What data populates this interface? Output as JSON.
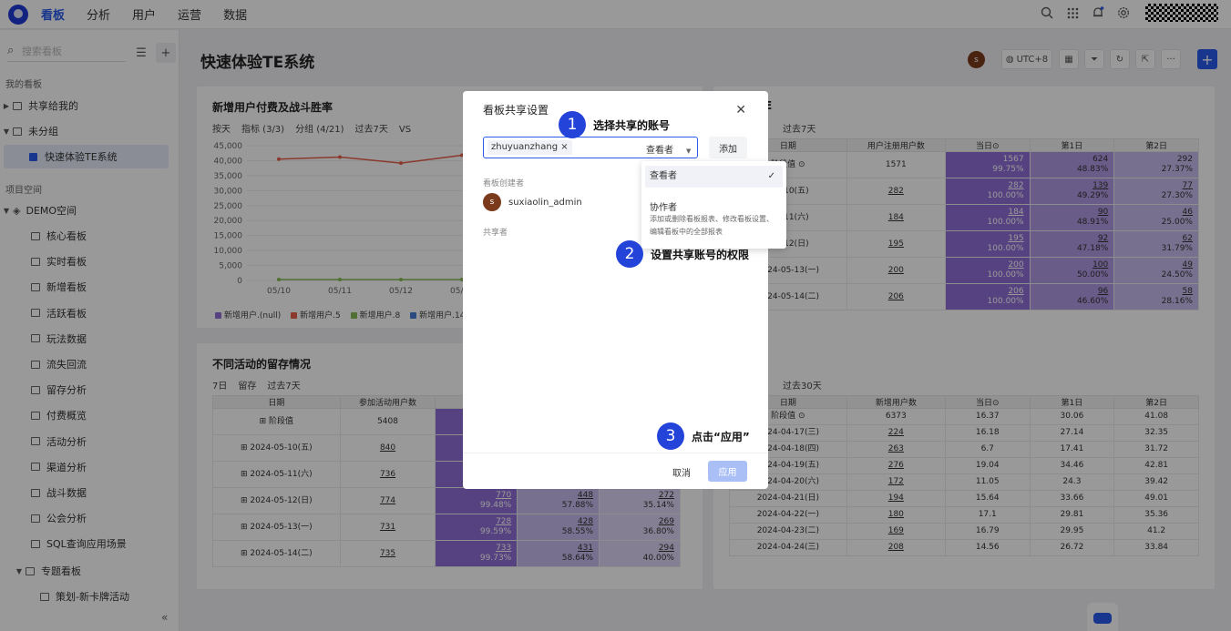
{
  "topnav": [
    "看板",
    "分析",
    "用户",
    "运营",
    "数据"
  ],
  "sidebar": {
    "search_placeholder": "搜索看板",
    "my_boards_label": "我的看板",
    "shared_to_me": "共享给我的",
    "ungrouped": "未分组",
    "selected_board": "快速体验TE系统",
    "project_space_label": "项目空间",
    "demo_space": "DEMO空间",
    "boards": [
      "核心看板",
      "实时看板",
      "新增看板",
      "活跃看板",
      "玩法数据",
      "流失回流",
      "留存分析",
      "付费概览",
      "活动分析",
      "渠道分析",
      "战斗数据",
      "公会分析",
      "SQL查询应用场景"
    ],
    "topic_group": "专题看板",
    "topic_item": "策划-新卡牌活动"
  },
  "page": {
    "title": "快速体验TE系统",
    "avatar": "s",
    "timezone": "UTC+8",
    "more": "···",
    "add": "+"
  },
  "card1": {
    "title": "新增用户付费及战斗胜率",
    "filters": [
      "按天",
      "指标 (3/3)",
      "分组 (4/21)",
      "过去7天",
      "VS"
    ],
    "legend": [
      "新增用户.(null)",
      "新增用户.5",
      "新增用户.8",
      "新增用户.14"
    ],
    "legend_colors": [
      "#8f6fd6",
      "#e8604c",
      "#88bb55",
      "#4a7fd6"
    ]
  },
  "chart_data": {
    "type": "line",
    "x": [
      "05/10",
      "05/11",
      "05/12",
      "05/13"
    ],
    "ylim": [
      0,
      45000
    ],
    "yticks": [
      "45,000",
      "40,000",
      "35,000",
      "30,000",
      "25,000",
      "20,000",
      "15,000",
      "10,000",
      "5,000",
      "0"
    ],
    "series": [
      {
        "name": "新增用户.5",
        "values": [
          40500,
          41200,
          39200,
          41800
        ]
      },
      {
        "name": "新增用户.8",
        "values": [
          300,
          300,
          300,
          300
        ]
      }
    ]
  },
  "card2": {
    "title": "不同活动的留存情况",
    "filters": [
      "7日",
      "留存",
      "过去7天"
    ],
    "headers": [
      "日期",
      "参加活动用户数"
    ],
    "rows": [
      {
        "date": "阶段值",
        "n": "5408",
        "c1": "",
        "c1b": "",
        "c2": "",
        "c2b": "",
        "c3": "",
        "c3b": ""
      },
      {
        "date": "2024-05-10(五)",
        "n": "840",
        "c1": "",
        "c1b": "",
        "c2": "",
        "c2b": "",
        "c3": "",
        "c3b": ""
      },
      {
        "date": "2024-05-11(六)",
        "n": "736",
        "c1": "",
        "c1b": "",
        "c2": "",
        "c2b": "",
        "c3": "",
        "c3b": ""
      },
      {
        "date": "2024-05-12(日)",
        "n": "774",
        "c1": "770",
        "c1b": "99.48%",
        "c2": "448",
        "c2b": "57.88%",
        "c3": "272",
        "c3b": "35.14%"
      },
      {
        "date": "2024-05-13(一)",
        "n": "731",
        "c1": "728",
        "c1b": "99.59%",
        "c2": "428",
        "c2b": "58.55%",
        "c3": "269",
        "c3b": "36.80%"
      },
      {
        "date": "2024-05-14(二)",
        "n": "735",
        "c1": "733",
        "c1b": "99.73%",
        "c2": "431",
        "c2b": "58.64%",
        "c3": "294",
        "c3b": "40.00%"
      }
    ]
  },
  "card3": {
    "title_fragment": "E",
    "filters": [
      "过去7天"
    ],
    "headers": [
      "日期",
      "用户注册用户数",
      "当日⊙",
      "第1日",
      "第2日"
    ],
    "rows": [
      {
        "date": "阶段值 ⊙",
        "n": "1571",
        "d0": "1567",
        "d0b": "99.75%",
        "d1": "624",
        "d1b": "48.83%",
        "d2": "292",
        "d2b": "27.37%"
      },
      {
        "date": "-05-10(五)",
        "n": "282",
        "d0": "282",
        "d0b": "100.00%",
        "d1": "139",
        "d1b": "49.29%",
        "d2": "77",
        "d2b": "27.30%"
      },
      {
        "date": "-05-11(六)",
        "n": "184",
        "d0": "184",
        "d0b": "100.00%",
        "d1": "90",
        "d1b": "48.91%",
        "d2": "46",
        "d2b": "25.00%"
      },
      {
        "date": "-05-12(日)",
        "n": "195",
        "d0": "195",
        "d0b": "100.00%",
        "d1": "92",
        "d1b": "47.18%",
        "d2": "62",
        "d2b": "31.79%"
      },
      {
        "date": "2024-05-13(一)",
        "n": "200",
        "d0": "200",
        "d0b": "100.00%",
        "d1": "100",
        "d1b": "50.00%",
        "d2": "49",
        "d2b": "24.50%"
      },
      {
        "date": "2024-05-14(二)",
        "n": "206",
        "d0": "206",
        "d0b": "100.00%",
        "d1": "96",
        "d1b": "46.60%",
        "d2": "58",
        "d2b": "28.16%"
      }
    ]
  },
  "card4": {
    "filters": [
      "过去30天"
    ],
    "headers": [
      "日期",
      "新增用户数",
      "当日⊙",
      "第1日",
      "第2日"
    ],
    "rows": [
      {
        "date": "阶段值 ⊙",
        "n": "6373",
        "d0": "16.37",
        "d1": "30.06",
        "d2": "41.08"
      },
      {
        "date": "2024-04-17(三)",
        "n": "224",
        "d0": "16.18",
        "d1": "27.14",
        "d2": "32.35"
      },
      {
        "date": "2024-04-18(四)",
        "n": "263",
        "d0": "6.7",
        "d1": "17.41",
        "d2": "31.72"
      },
      {
        "date": "2024-04-19(五)",
        "n": "276",
        "d0": "19.04",
        "d1": "34.46",
        "d2": "42.81"
      },
      {
        "date": "2024-04-20(六)",
        "n": "172",
        "d0": "11.05",
        "d1": "24.3",
        "d2": "39.42"
      },
      {
        "date": "2024-04-21(日)",
        "n": "194",
        "d0": "15.64",
        "d1": "33.66",
        "d2": "49.01"
      },
      {
        "date": "2024-04-22(一)",
        "n": "180",
        "d0": "17.1",
        "d1": "29.81",
        "d2": "35.36"
      },
      {
        "date": "2024-04-23(二)",
        "n": "169",
        "d0": "16.79",
        "d1": "29.95",
        "d2": "41.2"
      },
      {
        "date": "2024-04-24(三)",
        "n": "208",
        "d0": "14.56",
        "d1": "26.72",
        "d2": "33.84"
      }
    ]
  },
  "modal": {
    "title": "看板共享设置",
    "tag": "zhuyuanzhang",
    "tag_close": "×",
    "role_selected": "查看者",
    "add_button": "添加",
    "creator_label": "看板创建者",
    "creator_avatar": "s",
    "creator_name": "suxiaolin_admin",
    "sharer_label": "共享者",
    "cancel": "取消",
    "apply": "应用",
    "close": "✕"
  },
  "dropdown": {
    "opt1": "查看者",
    "opt1_check": "✓",
    "opt2": "协作者",
    "opt2_desc": "添加或删除看板报表、修改看板设置、编辑看板中的全部报表"
  },
  "callouts": [
    {
      "num": "1",
      "text": "选择共享的账号"
    },
    {
      "num": "2",
      "text": "设置共享账号的权限"
    },
    {
      "num": "3",
      "text": "点击“应用”"
    }
  ],
  "colors": {
    "accent": "#2b5aed",
    "callout": "#2443d9"
  }
}
